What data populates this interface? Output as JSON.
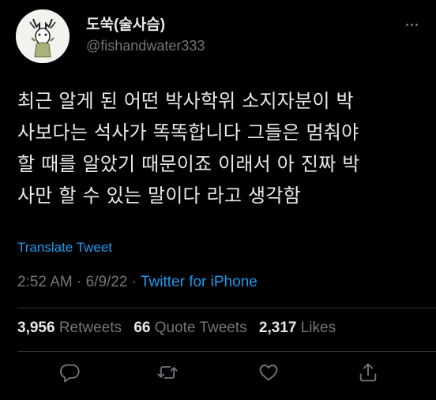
{
  "header": {
    "display_name": "도쑥(술사슴)",
    "handle": "@fishandwater333"
  },
  "tweet": {
    "text": "최근 알게 된 어떤 박사학위 소지자분이 박\n사보다는 석사가 똑똑합니다 그들은 멈춰야\n할 때를 알았기 때문이죠 이래서 아 진짜 박\n사만 할 수 있는 말이다 라고 생각함",
    "translate_label": "Translate Tweet",
    "time": "2:52 AM",
    "date": "6/9/22",
    "source": "Twitter for iPhone"
  },
  "stats": {
    "retweets_count": "3,956",
    "retweets_label": "Retweets",
    "quotes_count": "66",
    "quotes_label": "Quote Tweets",
    "likes_count": "2,317",
    "likes_label": "Likes"
  },
  "icons": [
    "more-icon",
    "reply-icon",
    "retweet-icon",
    "like-icon",
    "share-icon"
  ],
  "colors": {
    "background": "#000000",
    "accent": "#1d9bf0",
    "muted": "#71767b",
    "text": "#e7e9ea"
  }
}
